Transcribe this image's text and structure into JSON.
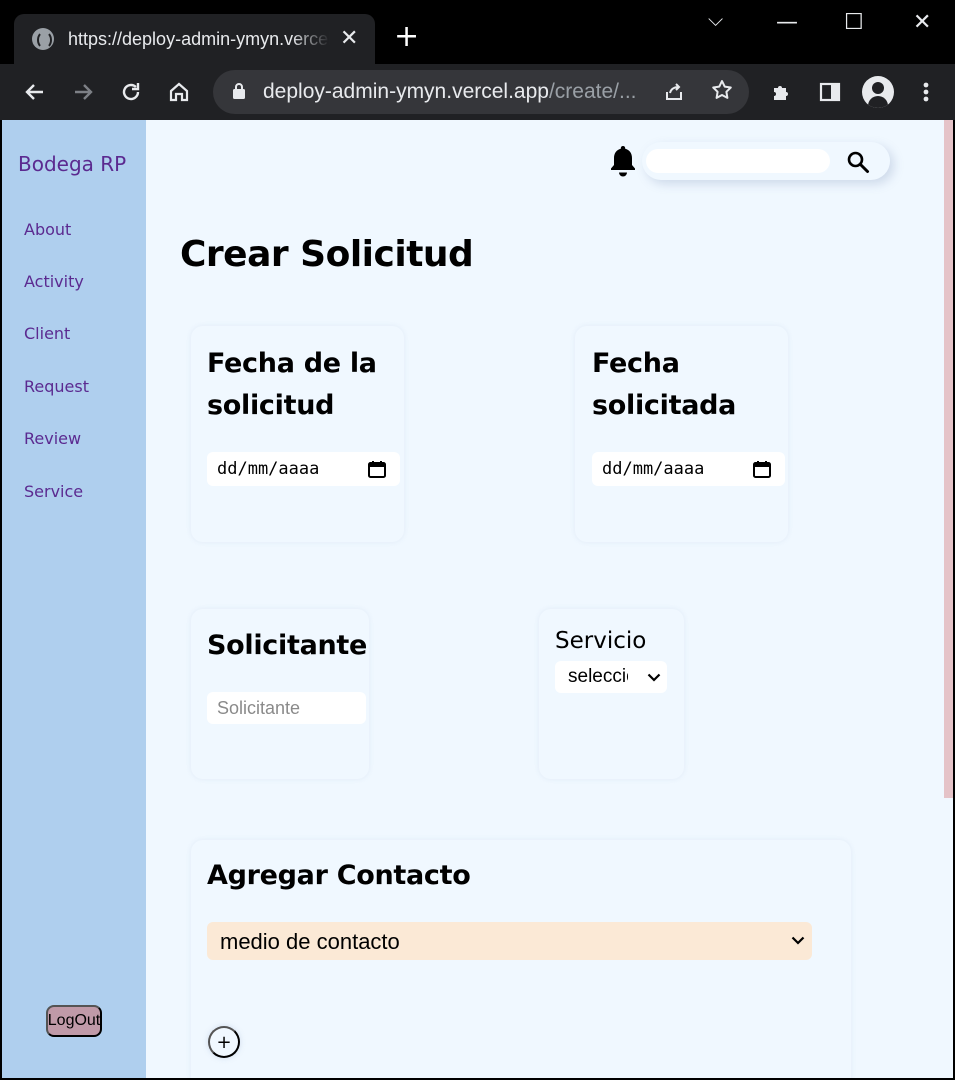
{
  "browser": {
    "tab_title": "https://deploy-admin-ymyn.vercel.app/create/request",
    "tab_close": "✕",
    "new_tab": "+",
    "url_host": "deploy-admin-ymyn.vercel.app",
    "url_path": "/create/...",
    "window_controls": {
      "dropdown": "⌵",
      "minimize": "—",
      "maximize": "☐",
      "close": "✕"
    }
  },
  "sidebar": {
    "brand": "Bodega RP",
    "items": [
      {
        "label": "About"
      },
      {
        "label": "Activity"
      },
      {
        "label": "Client"
      },
      {
        "label": "Request"
      },
      {
        "label": "Review"
      },
      {
        "label": "Service"
      }
    ],
    "logout": "LogOut"
  },
  "header": {
    "search_placeholder": ""
  },
  "main": {
    "title": "Crear Solicitud",
    "fecha_solicitud": {
      "label_line1": "Fecha de la",
      "label_line2": "solicitud",
      "value": "dd/mm/aaaa"
    },
    "fecha_solicitada": {
      "label_line1": "Fecha",
      "label_line2": "solicitada",
      "value": "dd/mm/aaaa"
    },
    "solicitante": {
      "label": "Solicitante",
      "placeholder": "Solicitante"
    },
    "servicio": {
      "label": "Servicio",
      "selected": "seleccione"
    },
    "contacto": {
      "label": "Agregar Contacto",
      "selected": "medio de contacto",
      "add": "+"
    }
  },
  "colors": {
    "sidebar_bg": "#afcfee",
    "page_bg": "#f0f8ff",
    "brand_text": "#5b2a90",
    "logout_bg": "#c09aa8",
    "contact_select_bg": "#fbe9d6"
  }
}
